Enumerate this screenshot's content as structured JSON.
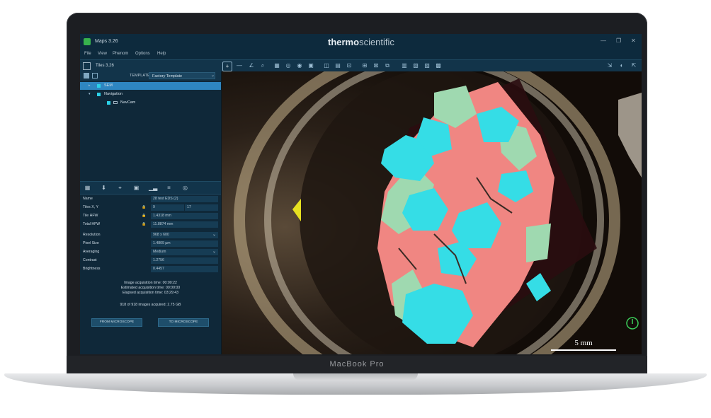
{
  "laptop": {
    "model": "MacBook Pro"
  },
  "app": {
    "title": "Maps 3.26",
    "brand_bold": "thermo",
    "brand_light": "scientific",
    "window_controls": [
      "—",
      "❐",
      "✕"
    ]
  },
  "menu": [
    "File",
    "View",
    "Phenom",
    "Options",
    "Help"
  ],
  "toolbar": {
    "tab_label": "Tiles 3.26",
    "tools": [
      "+",
      "—",
      "∠",
      "⌕",
      "▦",
      "◎",
      "◉",
      "▣",
      "◫",
      "▤",
      "⊡",
      "⊞",
      "⊠",
      "⧉",
      "▥",
      "▧",
      "▨",
      "▩",
      "⇲",
      "◐",
      "⇱"
    ]
  },
  "left_panel": {
    "template_label": "TEMPLATE",
    "template_value": "Factory Template",
    "tree": [
      {
        "label": "SEM",
        "selected": true,
        "level": 1
      },
      {
        "label": "Navigation",
        "selected": false,
        "level": 1
      },
      {
        "label": "NavCam",
        "selected": false,
        "level": 2
      }
    ],
    "properties": [
      {
        "name": "Name",
        "value": "28 test EDS (2)"
      },
      {
        "name": "Tiles X, Y",
        "value": "9",
        "value2": "17"
      },
      {
        "name": "Tile HFW",
        "value": "1.4318 mm"
      },
      {
        "name": "Total HFW",
        "value": "11.8874 mm"
      },
      {
        "name": "Resolution",
        "value": "968 x 600"
      },
      {
        "name": "Pixel Size",
        "value": "1.4809 µm"
      },
      {
        "name": "Averaging",
        "value": "Medium"
      },
      {
        "name": "Contrast",
        "value": "1.2756"
      },
      {
        "name": "Brightness",
        "value": "0.4457"
      }
    ],
    "stats": {
      "image_acq": "Image acquisition time: 00:00:22",
      "estimated": "Estimated acquisition time: 00:00:00",
      "elapsed": "Elapsed acquisition time: 03:29:43",
      "acquired": "918 of 918 images acquired;  2.75 GB"
    },
    "buttons": {
      "from": "FROM MICROSCOPE",
      "to": "TO MICROSCOPE"
    }
  },
  "viewport": {
    "scale_label": "5 mm"
  },
  "colors": {
    "phase_cyan": "#35dde6",
    "phase_pink": "#f08682",
    "phase_green": "#9fd9b0",
    "accent": "#2e86c1"
  }
}
